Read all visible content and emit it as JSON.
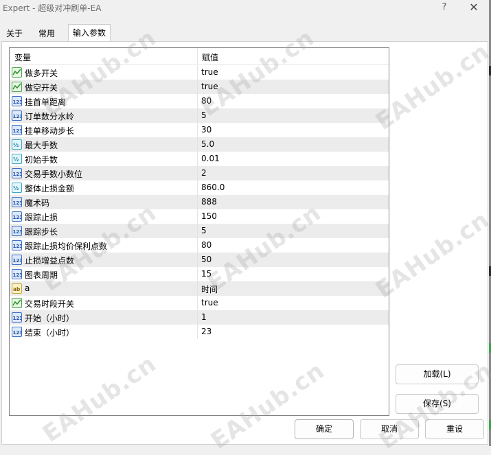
{
  "window": {
    "title": "Expert - 超级对冲刷单-EA",
    "help_glyph": "?",
    "close_glyph": "✕"
  },
  "tabs": [
    {
      "label": "关于"
    },
    {
      "label": "常用"
    },
    {
      "label": "输入参数"
    }
  ],
  "grid": {
    "col_variable": "变量",
    "col_value": "赋值",
    "rows": [
      {
        "name": "做多开关",
        "value": "true",
        "type": "bool"
      },
      {
        "name": "做空开关",
        "value": "true",
        "type": "bool"
      },
      {
        "name": "挂首单距离",
        "value": "80",
        "type": "int"
      },
      {
        "name": "订单数分水岭",
        "value": "5",
        "type": "int"
      },
      {
        "name": "挂单移动步长",
        "value": "30",
        "type": "int"
      },
      {
        "name": "最大手数",
        "value": "5.0",
        "type": "double"
      },
      {
        "name": "初始手数",
        "value": "0.01",
        "type": "double"
      },
      {
        "name": "交易手数小数位",
        "value": "2",
        "type": "int"
      },
      {
        "name": "整体止损金额",
        "value": "860.0",
        "type": "double"
      },
      {
        "name": "魔术码",
        "value": "888",
        "type": "int"
      },
      {
        "name": "跟踪止损",
        "value": "150",
        "type": "int"
      },
      {
        "name": "跟踪步长",
        "value": "5",
        "type": "int"
      },
      {
        "name": "跟踪止损均价保利点数",
        "value": "80",
        "type": "int"
      },
      {
        "name": "止损增益点数",
        "value": "50",
        "type": "int"
      },
      {
        "name": "图表周期",
        "value": "15",
        "type": "int"
      },
      {
        "name": "a",
        "value": "时间",
        "type": "string"
      },
      {
        "name": "交易时段开关",
        "value": "true",
        "type": "bool"
      },
      {
        "name": "开始（小时）",
        "value": "1",
        "type": "int"
      },
      {
        "name": "结束（小时）",
        "value": "23",
        "type": "int"
      }
    ]
  },
  "buttons": {
    "load": "加载(L)",
    "save": "保存(S)",
    "ok": "确定",
    "cancel": "取消",
    "reset": "重设"
  },
  "icons": {
    "bool": "bool-type-icon",
    "int": "int-type-icon",
    "double": "double-type-icon",
    "string": "string-type-icon"
  },
  "watermark": "EAHub.cn"
}
